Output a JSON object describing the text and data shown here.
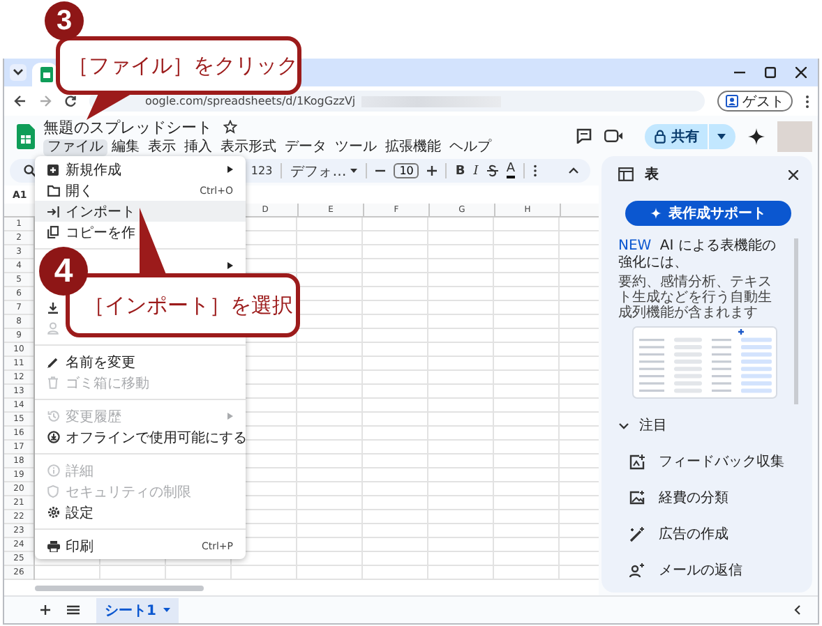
{
  "browser": {
    "url": "oogle.com/spreadsheets/d/1KogGzzVj",
    "profile_label": "ゲスト"
  },
  "document": {
    "title": "無題のスプレッドシート",
    "menus": [
      {
        "label": "ファイル",
        "selected": true
      },
      {
        "label": "編集",
        "selected": false
      },
      {
        "label": "表示",
        "selected": false
      },
      {
        "label": "挿入",
        "selected": false
      },
      {
        "label": "表示形式",
        "selected": false
      },
      {
        "label": "データ",
        "selected": false
      },
      {
        "label": "ツール",
        "selected": false
      },
      {
        "label": "拡張機能",
        "selected": false
      },
      {
        "label": "ヘルプ",
        "selected": false
      }
    ]
  },
  "share_button": "共有",
  "toolbar": {
    "number_format": "123",
    "font": "デフォ…",
    "font_size": "10",
    "bold": "B",
    "italic": "I",
    "text_color": "A"
  },
  "name_box": "A1",
  "file_menu": {
    "items": [
      {
        "kind": "item",
        "label": "新規作成",
        "submenu": true,
        "disabled": false,
        "selected": false
      },
      {
        "kind": "item",
        "label": "開く",
        "shortcut": "Ctrl+O",
        "disabled": false,
        "selected": false
      },
      {
        "kind": "item",
        "label": "インポート",
        "disabled": false,
        "selected": true
      },
      {
        "kind": "item",
        "label": "コピーを作",
        "disabled": false,
        "selected": false
      },
      {
        "kind": "divider"
      },
      {
        "kind": "item",
        "submenu": true,
        "selected": false
      },
      {
        "kind": "item",
        "selected": false
      },
      {
        "kind": "item",
        "disabled": false,
        "selected": false
      },
      {
        "kind": "item",
        "disabled": true,
        "selected": false
      },
      {
        "kind": "divider"
      },
      {
        "kind": "item",
        "label": "名前を変更",
        "disabled": false,
        "selected": false
      },
      {
        "kind": "item",
        "label": "ゴミ箱に移動",
        "disabled": true,
        "selected": false
      },
      {
        "kind": "divider"
      },
      {
        "kind": "item",
        "label": "変更履歴",
        "submenu": true,
        "disabled": true,
        "selected": false
      },
      {
        "kind": "item",
        "label": "オフラインで使用可能にする",
        "disabled": false,
        "selected": false
      },
      {
        "kind": "divider"
      },
      {
        "kind": "item",
        "label": "詳細",
        "disabled": true,
        "selected": false
      },
      {
        "kind": "item",
        "label": "セキュリティの制限",
        "disabled": true,
        "selected": false
      },
      {
        "kind": "item",
        "label": "設定",
        "disabled": false,
        "selected": false
      },
      {
        "kind": "divider"
      },
      {
        "kind": "item",
        "label": "印刷",
        "shortcut": "Ctrl+P",
        "disabled": false,
        "selected": false
      }
    ]
  },
  "grid": {
    "columns": [
      "D",
      "E",
      "F",
      "G",
      "H"
    ],
    "rows": [
      "1",
      "2",
      "3",
      "4",
      "5",
      "6",
      "7",
      "8",
      "9",
      "10",
      "11",
      "12",
      "13",
      "14",
      "15",
      "16",
      "17",
      "18",
      "19",
      "20",
      "21",
      "22",
      "23",
      "24",
      "25",
      "26"
    ]
  },
  "side_panel": {
    "title": "表",
    "action_button": "表作成サポート",
    "promo_badge": "NEW",
    "promo_title": "AI による表機能の強化には、",
    "promo_text": "要約、感情分析、テキスト生成などを行う自動生成列機能が含まれます",
    "section": {
      "label": "注目",
      "expanded": true
    },
    "items": [
      {
        "label": "フィードバック収集"
      },
      {
        "label": "経費の分類"
      },
      {
        "label": "広告の作成"
      },
      {
        "label": "メールの返信"
      }
    ]
  },
  "sheet_tabs": [
    {
      "label": "シート1",
      "selected": true
    }
  ],
  "callouts": [
    {
      "step": "3",
      "text": "［ファイル］をクリック"
    },
    {
      "step": "4",
      "text": "［インポート］を選択"
    }
  ]
}
